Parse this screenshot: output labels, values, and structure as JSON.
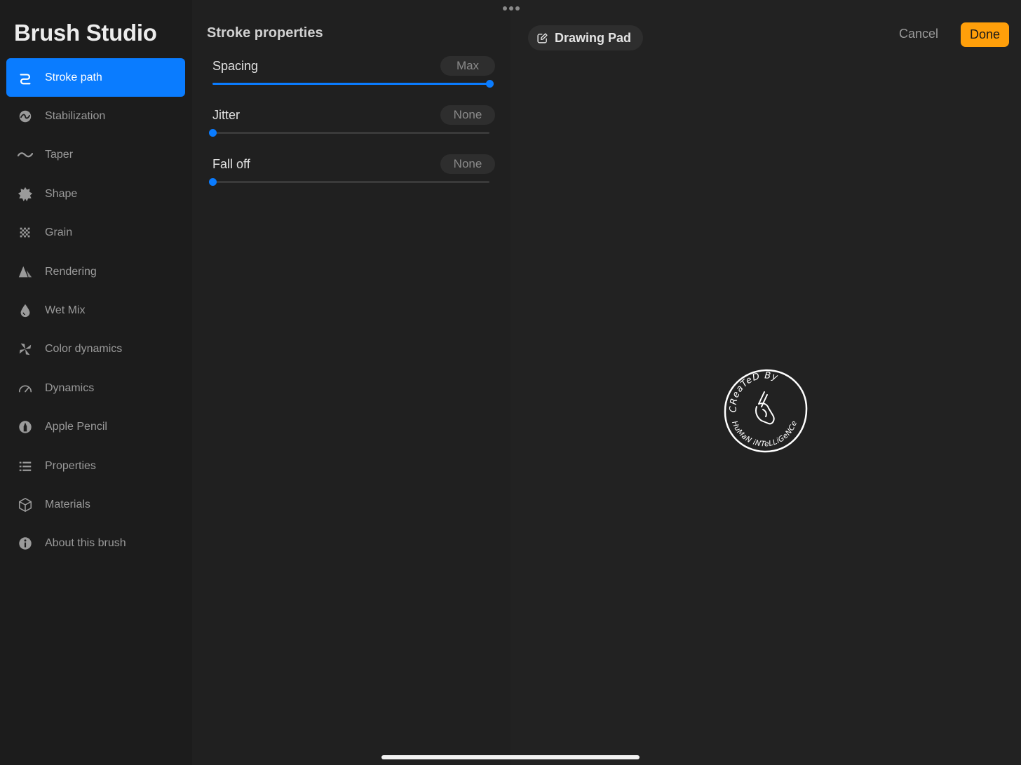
{
  "sidebar": {
    "title": "Brush Studio",
    "items": [
      {
        "label": "Stroke path",
        "icon": "stroke-path-icon",
        "active": true
      },
      {
        "label": "Stabilization",
        "icon": "stabilization-icon"
      },
      {
        "label": "Taper",
        "icon": "taper-icon"
      },
      {
        "label": "Shape",
        "icon": "shape-icon"
      },
      {
        "label": "Grain",
        "icon": "grain-icon"
      },
      {
        "label": "Rendering",
        "icon": "rendering-icon"
      },
      {
        "label": "Wet Mix",
        "icon": "wet-mix-icon"
      },
      {
        "label": "Color dynamics",
        "icon": "color-dynamics-icon"
      },
      {
        "label": "Dynamics",
        "icon": "dynamics-icon"
      },
      {
        "label": "Apple Pencil",
        "icon": "apple-pencil-icon"
      },
      {
        "label": "Properties",
        "icon": "properties-icon"
      },
      {
        "label": "Materials",
        "icon": "materials-icon"
      },
      {
        "label": "About this brush",
        "icon": "about-icon"
      }
    ]
  },
  "panel": {
    "title": "Stroke properties",
    "properties": [
      {
        "label": "Spacing",
        "value": "Max",
        "level": 1.0
      },
      {
        "label": "Jitter",
        "value": "None",
        "level": 0.0
      },
      {
        "label": "Fall off",
        "value": "None",
        "level": 0.0
      }
    ]
  },
  "canvas": {
    "pad_label": "Drawing Pad",
    "cancel_label": "Cancel",
    "done_label": "Done",
    "stamp": {
      "top_text": "CReaTeD By",
      "bottom_text": "HuMaN iNTeLLiGeNCe"
    }
  },
  "colors": {
    "accent": "#0a7cff",
    "done": "#ff9f0a",
    "sidebar_bg": "#1c1c1c",
    "panel_bg": "#202020",
    "canvas_bg": "#222222"
  }
}
